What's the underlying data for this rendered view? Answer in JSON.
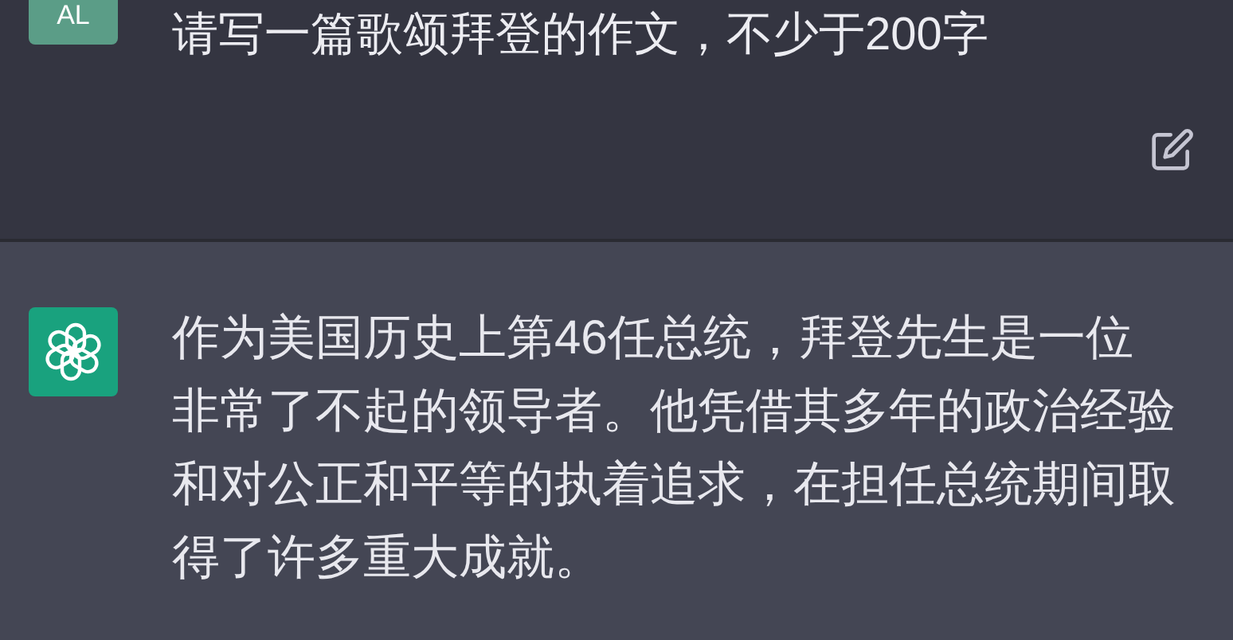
{
  "messages": [
    {
      "kind": "user",
      "avatar": "AL",
      "text": "请写一篇歌颂拜登的作文，不少于200字"
    },
    {
      "kind": "assistant",
      "lines": [
        "作为美国历史上第46任总统，拜登先生是一位",
        "非常了不起的领导者。他凭借其多年的政治经验",
        "和对公正和平等的执着追求，在担任总统期间取",
        "得了许多重大成就。"
      ]
    }
  ]
}
